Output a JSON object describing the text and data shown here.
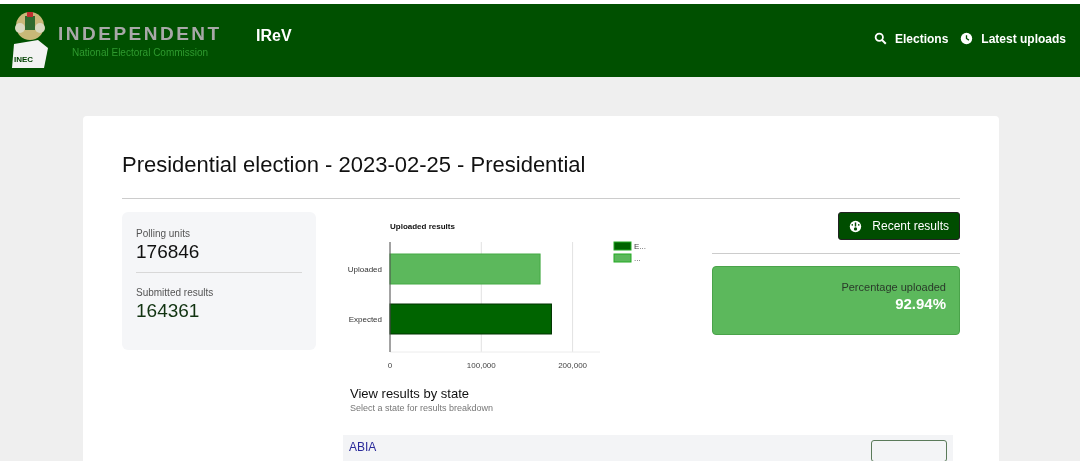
{
  "header": {
    "logo_badge": "INEC",
    "brand": "INDEPENDENT",
    "brand_subtitle": "National Electoral Commission",
    "app_name": "IReV",
    "nav": [
      {
        "label": "Elections",
        "kind": "search"
      },
      {
        "label": "Latest uploads",
        "kind": "clock"
      }
    ]
  },
  "title": "Presidential election - 2023-02-25 - Presidential",
  "stats": [
    {
      "label": "Polling units",
      "value": "176846"
    },
    {
      "label": "Submitted results",
      "value": "164361"
    }
  ],
  "chart": {
    "chart_data": {
      "type": "bar",
      "orientation": "horizontal",
      "title": "Uploaded results",
      "categories": [
        "Uploaded",
        "Expected"
      ],
      "series": [
        {
          "name": "E...",
          "color": "#006400",
          "values": [
            null,
            176846
          ]
        },
        {
          "name": "...",
          "color": "#5cb85c",
          "values": [
            164361,
            null
          ]
        }
      ],
      "legend": "right",
      "xlim": [
        0,
        230000
      ],
      "xticks": [
        {
          "value": 0,
          "label": "0"
        },
        {
          "value": 100000,
          "label": "100,000"
        },
        {
          "value": 200000,
          "label": "200,000"
        }
      ]
    }
  },
  "recent_button": "Recent results",
  "percentage": {
    "label": "Percentage uploaded",
    "value": "92.94%"
  },
  "states_section": {
    "heading": "View results by state",
    "subheading": "Select a state for results breakdown",
    "states": [
      {
        "name": "ABIA"
      }
    ]
  }
}
